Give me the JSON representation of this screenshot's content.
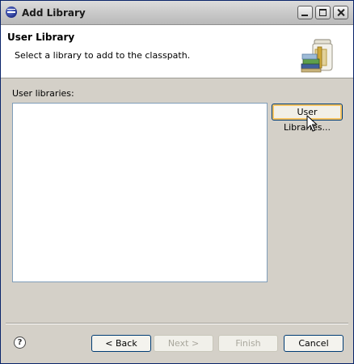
{
  "window": {
    "title": "Add Library"
  },
  "banner": {
    "title": "User Library",
    "description": "Select a library to add to the classpath."
  },
  "main": {
    "list_label": "User libraries:",
    "user_libraries_button": "User Libraries...",
    "libraries": []
  },
  "footer": {
    "help_icon": "?",
    "back": "< Back",
    "next": "Next >",
    "finish": "Finish",
    "cancel": "Cancel"
  },
  "icons": {
    "app": "eclipse-icon",
    "banner": "library-jar-icon",
    "help": "help-icon"
  },
  "colors": {
    "window_bg": "#d4d0c8",
    "focus_ring": "#f7c463",
    "button_border": "#003c74",
    "list_border": "#7f9db9"
  }
}
